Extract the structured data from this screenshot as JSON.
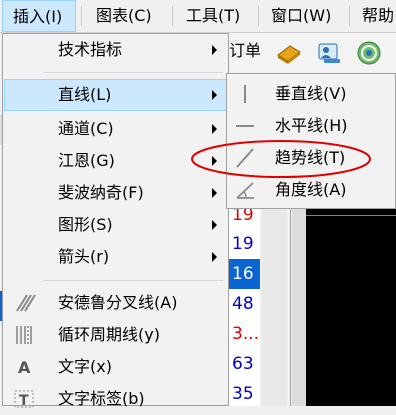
{
  "menubar": {
    "items": [
      {
        "label": "插入(I)",
        "active": true
      },
      {
        "label": "图表(C)"
      },
      {
        "label": "工具(T)"
      },
      {
        "label": "窗口(W)"
      },
      {
        "label": "帮助"
      }
    ]
  },
  "toolbar": {
    "partial_text": "订单",
    "icons": [
      "order-book-icon",
      "user-profile-icon",
      "signal-icon"
    ]
  },
  "background": {
    "numbers": [
      "19",
      "19",
      "16",
      "48",
      "3...",
      "63",
      "35"
    ],
    "selected_index": 2,
    "colors": {
      "red": "#e00000",
      "blue": "#0000cc",
      "selection": "#0a64d2"
    }
  },
  "menu": {
    "items": [
      {
        "label": "技术指标",
        "submenu": true
      },
      {
        "label": "直线(L)",
        "submenu": true,
        "highlighted": true
      },
      {
        "label": "通道(C)",
        "submenu": true
      },
      {
        "label": "江恩(G)",
        "submenu": true
      },
      {
        "label": "斐波纳奇(F)",
        "submenu": true
      },
      {
        "label": "图形(S)",
        "submenu": true
      },
      {
        "label": "箭头(r)",
        "submenu": true
      },
      {
        "label": "安德鲁分叉线(A)",
        "icon": "andrews-pitchfork-icon"
      },
      {
        "label": "循环周期线(y)",
        "icon": "cycle-lines-icon"
      },
      {
        "label": "文字(x)",
        "icon": "text-icon"
      },
      {
        "label": "文字标签(b)",
        "icon": "text-label-icon"
      }
    ]
  },
  "submenu": {
    "items": [
      {
        "label": "垂直线(V)",
        "icon": "vertical-line-icon"
      },
      {
        "label": "水平线(H)",
        "icon": "horizontal-line-icon"
      },
      {
        "label": "趋势线(T)",
        "icon": "trendline-icon",
        "circled": true
      },
      {
        "label": "角度线(A)",
        "icon": "angle-line-icon"
      }
    ]
  },
  "annotation_color": "#e00000"
}
